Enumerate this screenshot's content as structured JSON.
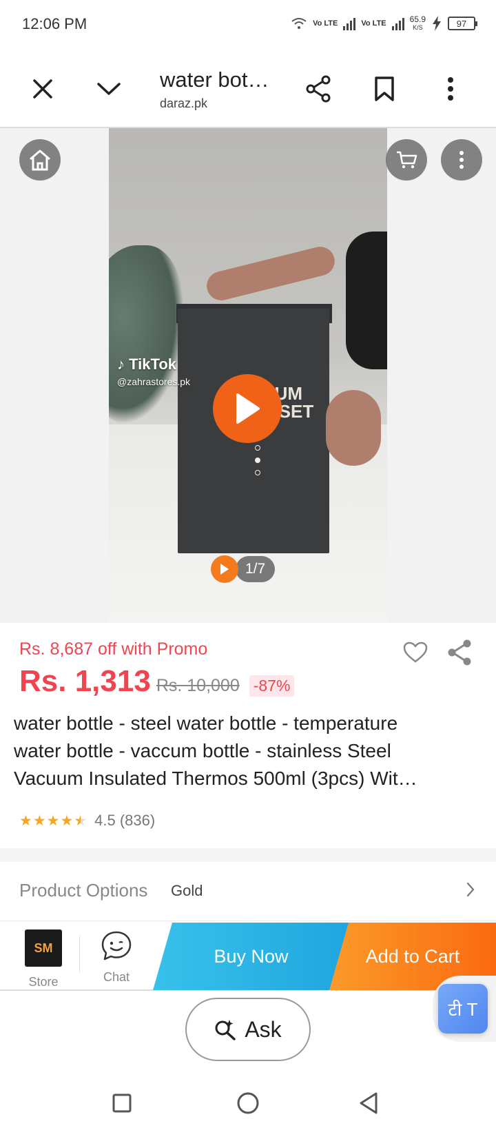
{
  "status": {
    "time": "12:06 PM",
    "net1": "Vo LTE",
    "net2": "Vo LTE",
    "speed_value": "65.9",
    "speed_unit": "K/S",
    "battery": "97"
  },
  "browser": {
    "title": "water bot…",
    "domain": "daraz.pk",
    "icons": [
      "close-icon",
      "chevron-down-icon",
      "share-icon",
      "bookmark-icon",
      "more-icon"
    ]
  },
  "media": {
    "tiktok_logo": "TikTok",
    "tiktok_user": "@zahrastores.pk",
    "counter": "1/7",
    "icons": [
      "home-icon",
      "cart-icon",
      "more-icon",
      "play-icon"
    ]
  },
  "product": {
    "promo": "Rs. 8,687 off with Promo",
    "price": "Rs. 1,313",
    "old_price": "Rs. 10,000",
    "discount": "-87%",
    "title_line1": "water bottle - steel water bottle - temperature",
    "title_line2": "water bottle - vaccum bottle - stainless Steel",
    "title_line3": "Vacuum Insulated Thermos 500ml (3pcs) Wit…",
    "rating": 4.5,
    "rating_text": "4.5 (836)",
    "accent_color": "#f04550"
  },
  "options": {
    "label": "Product Options",
    "value": "Gold"
  },
  "action_bar": {
    "store_label": "Store",
    "chat_label": "Chat",
    "buy_now": "Buy Now",
    "add_to_cart": "Add to Cart",
    "buy_color": "#20a6df",
    "cart_color": "#fb6a10"
  },
  "ask": {
    "label": "Ask"
  },
  "nav": {
    "icons": [
      "recents-square-icon",
      "home-circle-icon",
      "back-triangle-icon"
    ]
  }
}
